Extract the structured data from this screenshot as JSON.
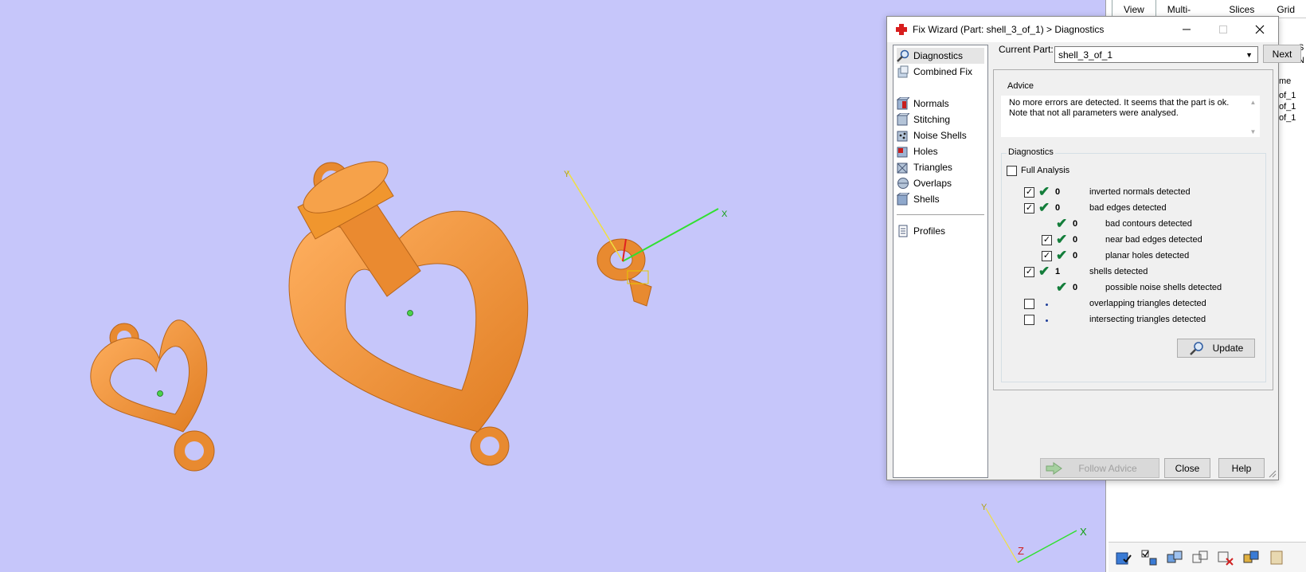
{
  "background_panel": {
    "tabs": [
      "View",
      "Multi-Section",
      "Slices",
      "Grid"
    ],
    "fragments": [
      "p",
      "S",
      "N",
      "me",
      "of_1",
      "of_1",
      "of_1"
    ]
  },
  "axes": {
    "x": "X",
    "y": "Y",
    "z": "Z"
  },
  "dialog": {
    "title": "Fix Wizard (Part: shell_3_of_1) > Diagnostics",
    "nav": {
      "diagnostics": "Diagnostics",
      "combined_fix": "Combined Fix",
      "normals": "Normals",
      "stitching": "Stitching",
      "noise_shells": "Noise Shells",
      "holes": "Holes",
      "triangles": "Triangles",
      "overlaps": "Overlaps",
      "shells": "Shells",
      "profiles": "Profiles"
    },
    "current_part_label": "Current Part:",
    "current_part_value": "shell_3_of_1",
    "next_label": "Next",
    "advice_legend": "Advice",
    "advice_text_1": "No more errors are detected. It seems that the part is ok.",
    "advice_text_2": "Note that not all parameters were analysed.",
    "diagnostics_legend": "Diagnostics",
    "full_analysis_label": "Full Analysis",
    "rows": [
      {
        "checked": true,
        "tick": true,
        "count": "0",
        "label": "inverted normals detected"
      },
      {
        "checked": true,
        "tick": true,
        "count": "0",
        "label": "bad edges detected"
      },
      {
        "checked": null,
        "tick": true,
        "count": "0",
        "label": "bad contours detected"
      },
      {
        "checked": true,
        "tick": true,
        "count": "0",
        "label": "near bad edges detected"
      },
      {
        "checked": true,
        "tick": true,
        "count": "0",
        "label": "planar holes detected"
      },
      {
        "checked": true,
        "tick": true,
        "count": "1",
        "label": "shells detected"
      },
      {
        "checked": null,
        "tick": true,
        "count": "0",
        "label": "possible noise shells detected"
      },
      {
        "checked": false,
        "tick": false,
        "count": "",
        "label": "overlapping triangles detected"
      },
      {
        "checked": false,
        "tick": false,
        "count": "",
        "label": "intersecting triangles detected"
      }
    ],
    "update_label": "Update",
    "follow_advice_label": "Follow Advice",
    "close_label": "Close",
    "help_label": "Help"
  },
  "colors": {
    "background": "#c6c6fa",
    "part": "#f5963c",
    "tick": "#137d3a"
  }
}
